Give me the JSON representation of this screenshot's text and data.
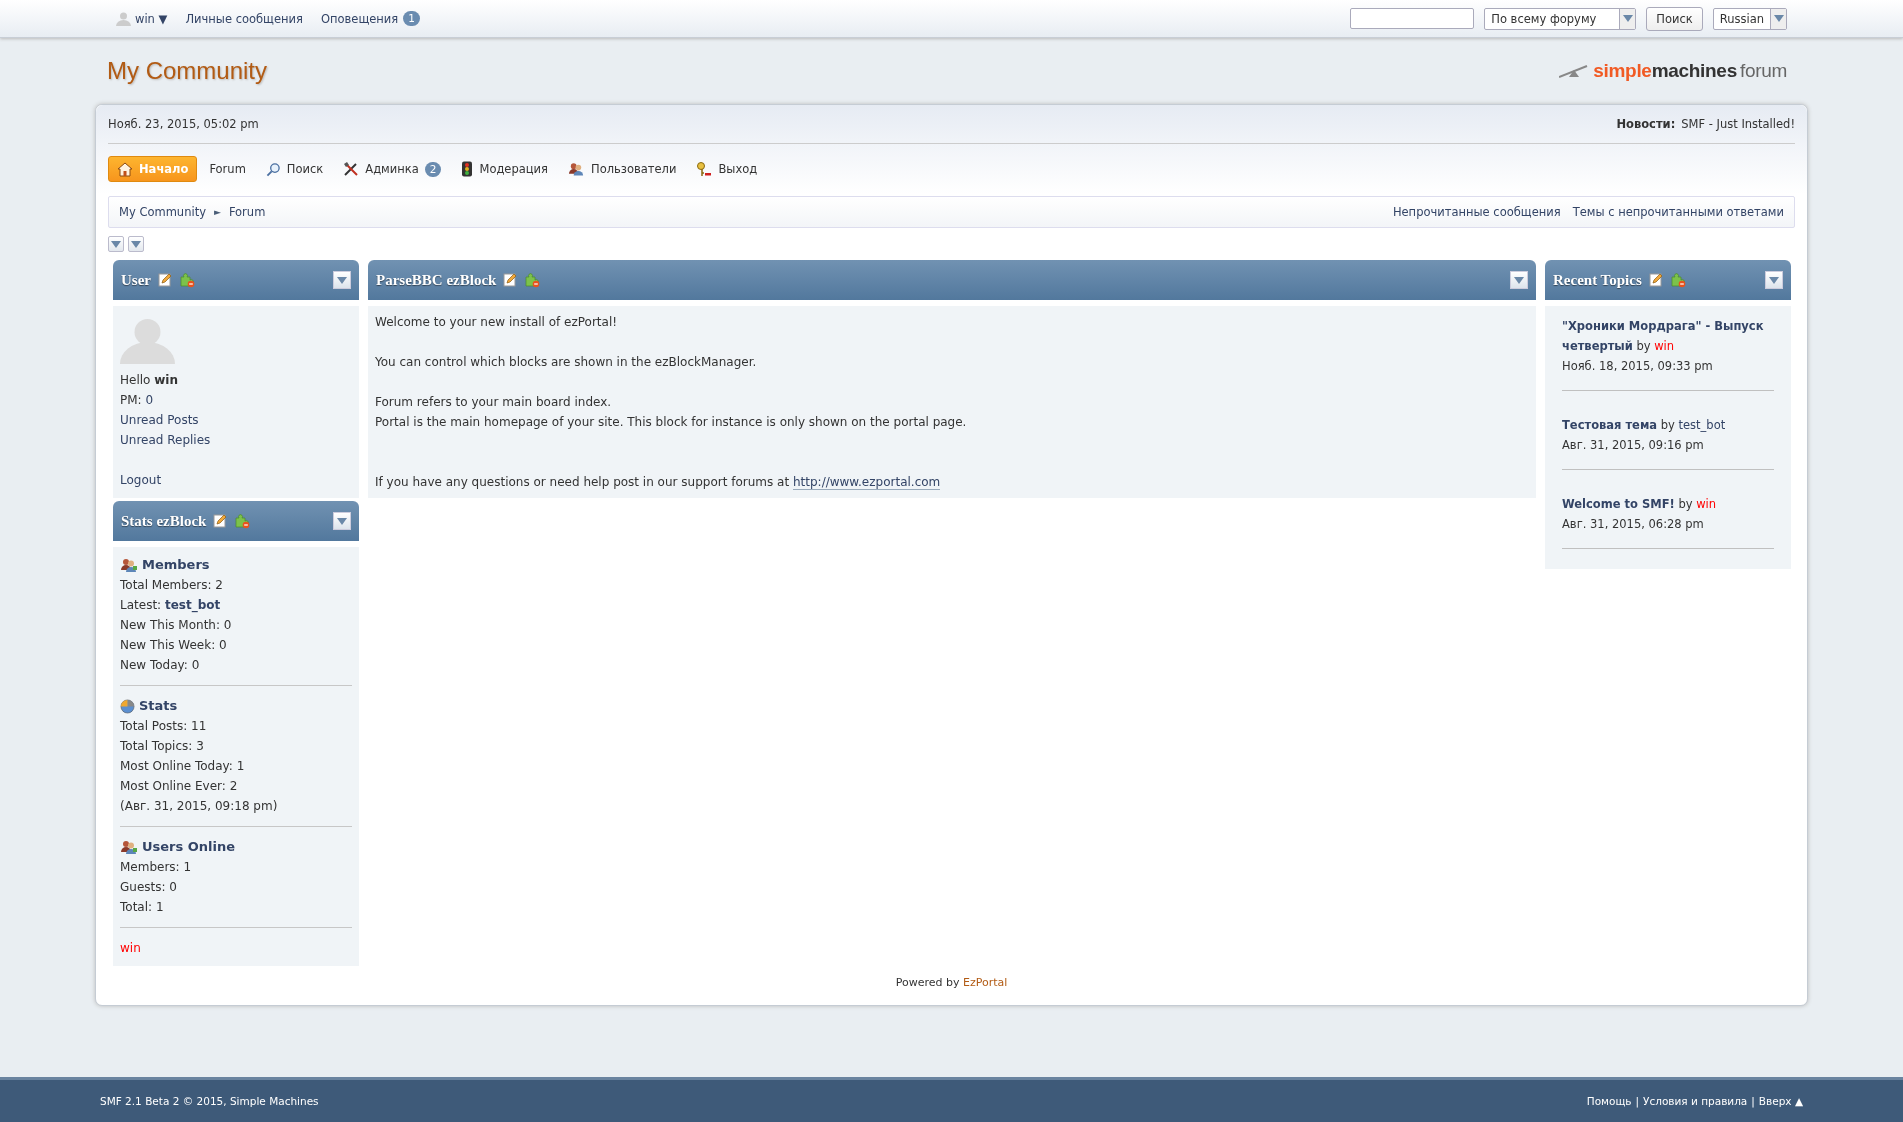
{
  "top_bar": {
    "user": "win ▼",
    "links": [
      {
        "label": "Личные сообщения"
      },
      {
        "label": "Оповещения",
        "badge": "1"
      }
    ],
    "search_scope": "По всему форуму",
    "search_button": "Поиск",
    "language": "Russian"
  },
  "header": {
    "title": "My Community",
    "logo": {
      "part1": "simple",
      "part2": "machines",
      "part3": "forum"
    }
  },
  "upper": {
    "date": "Нояб. 23, 2015, 05:02 pm",
    "news_label": "Новости:",
    "news": "SMF - Just Installed!"
  },
  "menu": [
    {
      "label": "Начало",
      "selected": true
    },
    {
      "label": "Forum",
      "selected": false
    },
    {
      "label": "Поиск",
      "selected": false
    },
    {
      "label": "Админка",
      "selected": false,
      "badge": "2"
    },
    {
      "label": "Модерация",
      "selected": false
    },
    {
      "label": "Пользователи",
      "selected": false
    },
    {
      "label": "Выход",
      "selected": false
    }
  ],
  "breadcrumb": [
    "My Community",
    "Forum"
  ],
  "breadcrumb_separator": "►",
  "quick_links": [
    "Непрочитанные сообщения",
    "Темы с непрочитанными ответами"
  ],
  "user_block": {
    "title": "User",
    "greeting": "Hello **win**",
    "pm_label": "PM:",
    "pm_value": "0",
    "links": [
      "Unread Posts",
      "Unread Replies"
    ],
    "logout": "Logout"
  },
  "stats_block": {
    "title": "Stats ezBlock",
    "sections": [
      {
        "title": "Members",
        "lines": [
          "Total Members: 2",
          "Latest: **test_bot**",
          "New This Month: 0",
          "New This Week: 0",
          "New Today: 0"
        ]
      },
      {
        "title": "Stats",
        "lines": [
          "Total Posts: 11",
          "Total Topics: 3",
          "Most Online Today: 1",
          "Most Online Ever: 2",
          "(Авг. 31, 2015, 09:18 pm)"
        ]
      },
      {
        "title": "Users Online",
        "lines": [
          "Members: 1",
          "Guests: 0",
          "Total: 1"
        ]
      }
    ],
    "online_users": [
      {
        "name": "win",
        "color": "#ff0000"
      }
    ]
  },
  "center_block": {
    "title": "ParseBBC ezBlock",
    "paragraphs": [
      {
        "lines": [
          "Welcome to your new install of ezPortal!"
        ]
      },
      {
        "lines": [
          "You can control which blocks are shown in the ezBlockManager."
        ]
      },
      {
        "lines": [
          "Forum refers to your main board index.",
          "Portal is the main homepage of your site. This block for instance is only shown on the portal page."
        ]
      }
    ],
    "help_text": "If you have any questions or need help post in our support forums at",
    "help_link": "http://www.ezportal.com"
  },
  "recent_topics": {
    "title": "Recent Topics",
    "items": [
      {
        "title": "\"Хроники Мордрага\" - Выпуск четвертый",
        "by": "by",
        "author": "win",
        "color": "#ff0000",
        "date": "Нояб. 18, 2015, 09:33 pm"
      },
      {
        "title": "Тестовая тема",
        "by": "by",
        "author": "test_bot",
        "color": "#334466",
        "date": "Авг. 31, 2015, 09:16 pm"
      },
      {
        "title": "Welcome to SMF!",
        "by": "by",
        "author": "win",
        "color": "#ff0000",
        "date": "Авг. 31, 2015, 06:28 pm"
      }
    ]
  },
  "powered": {
    "text": "Powered by",
    "link": "EzPortal"
  },
  "footer": {
    "copyright": "SMF 2.1 Beta 2 © 2015, Simple Machines",
    "links": [
      "Помощь",
      "Условия и правила",
      "Вверх ▲"
    ],
    "separator": "|"
  }
}
